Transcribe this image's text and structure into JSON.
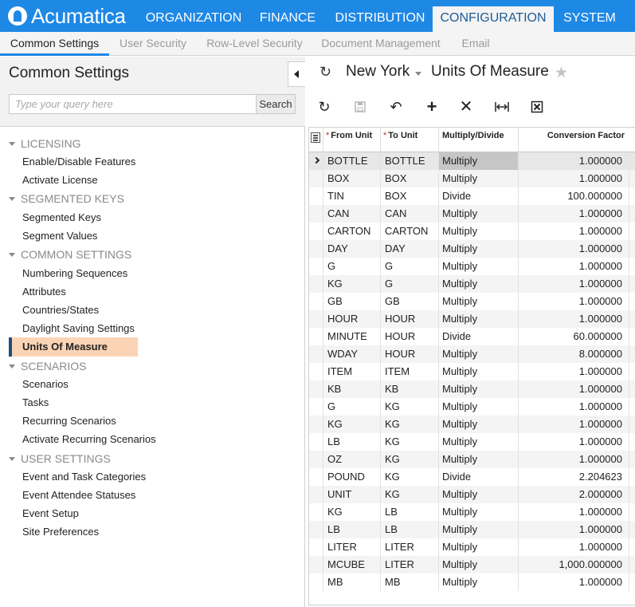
{
  "app": {
    "logo_text": "Acumatica",
    "top_tabs": [
      "ORGANIZATION",
      "FINANCE",
      "DISTRIBUTION",
      "CONFIGURATION",
      "SYSTEM"
    ],
    "active_top_tab": "CONFIGURATION",
    "sub_tabs": [
      "Common Settings",
      "User Security",
      "Row-Level Security",
      "Document Management",
      "Email"
    ],
    "active_sub_tab": "Common Settings",
    "accent_color": "#1e88e5",
    "highlight_color": "#fbd4b6"
  },
  "sidebar": {
    "title": "Common Settings",
    "search_placeholder": "Type your query here",
    "search_button": "Search",
    "groups": [
      {
        "label": "LICENSING",
        "items": [
          "Enable/Disable Features",
          "Activate License"
        ]
      },
      {
        "label": "SEGMENTED KEYS",
        "items": [
          "Segmented Keys",
          "Segment Values"
        ]
      },
      {
        "label": "COMMON SETTINGS",
        "items": [
          "Numbering Sequences",
          "Attributes",
          "Countries/States",
          "Daylight Saving Settings",
          "Units Of Measure"
        ]
      },
      {
        "label": "SCENARIOS",
        "items": [
          "Scenarios",
          "Tasks",
          "Recurring Scenarios",
          "Activate Recurring Scenarios"
        ]
      },
      {
        "label": "USER SETTINGS",
        "items": [
          "Event and Task Categories",
          "Event Attendee Statuses",
          "Event Setup",
          "Site Preferences"
        ]
      }
    ],
    "active_item": "Units Of Measure"
  },
  "main": {
    "branch": "New York",
    "screen_title": "Units Of Measure",
    "toolbar_icons": [
      "refresh-icon",
      "save-icon",
      "undo-icon",
      "add-row-icon",
      "delete-row-icon",
      "fit-columns-icon",
      "export-excel-icon"
    ],
    "grid": {
      "columns": [
        {
          "label": "From Unit",
          "required": true
        },
        {
          "label": "To Unit",
          "required": true
        },
        {
          "label": "Multiply/Divide",
          "required": false
        },
        {
          "label": "Conversion Factor",
          "required": false
        }
      ],
      "rows": [
        [
          "BOTTLE",
          "BOTTLE",
          "Multiply",
          "1.000000"
        ],
        [
          "BOX",
          "BOX",
          "Multiply",
          "1.000000"
        ],
        [
          "TIN",
          "BOX",
          "Divide",
          "100.000000"
        ],
        [
          "CAN",
          "CAN",
          "Multiply",
          "1.000000"
        ],
        [
          "CARTON",
          "CARTON",
          "Multiply",
          "1.000000"
        ],
        [
          "DAY",
          "DAY",
          "Multiply",
          "1.000000"
        ],
        [
          "G",
          "G",
          "Multiply",
          "1.000000"
        ],
        [
          "KG",
          "G",
          "Multiply",
          "1.000000"
        ],
        [
          "GB",
          "GB",
          "Multiply",
          "1.000000"
        ],
        [
          "HOUR",
          "HOUR",
          "Multiply",
          "1.000000"
        ],
        [
          "MINUTE",
          "HOUR",
          "Divide",
          "60.000000"
        ],
        [
          "WDAY",
          "HOUR",
          "Multiply",
          "8.000000"
        ],
        [
          "ITEM",
          "ITEM",
          "Multiply",
          "1.000000"
        ],
        [
          "KB",
          "KB",
          "Multiply",
          "1.000000"
        ],
        [
          "G",
          "KG",
          "Multiply",
          "1.000000"
        ],
        [
          "KG",
          "KG",
          "Multiply",
          "1.000000"
        ],
        [
          "LB",
          "KG",
          "Multiply",
          "1.000000"
        ],
        [
          "OZ",
          "KG",
          "Multiply",
          "1.000000"
        ],
        [
          "POUND",
          "KG",
          "Divide",
          "2.204623"
        ],
        [
          "UNIT",
          "KG",
          "Multiply",
          "2.000000"
        ],
        [
          "KG",
          "LB",
          "Multiply",
          "1.000000"
        ],
        [
          "LB",
          "LB",
          "Multiply",
          "1.000000"
        ],
        [
          "LITER",
          "LITER",
          "Multiply",
          "1.000000"
        ],
        [
          "MCUBE",
          "LITER",
          "Multiply",
          "1,000.000000"
        ],
        [
          "MB",
          "MB",
          "Multiply",
          "1.000000"
        ]
      ],
      "current_row": 0
    }
  }
}
